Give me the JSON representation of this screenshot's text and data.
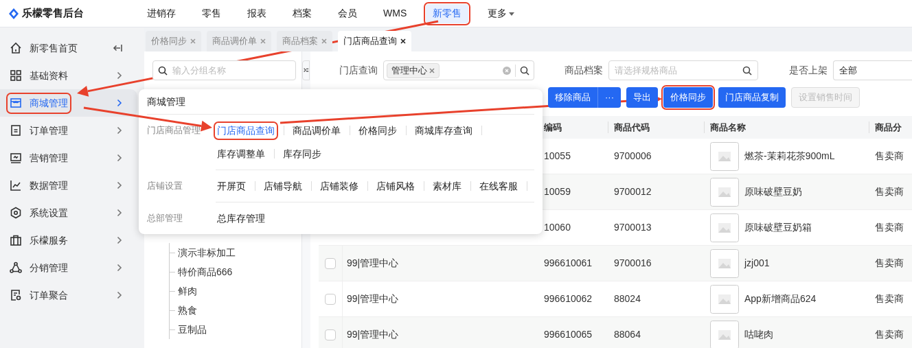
{
  "app": {
    "title": "乐檬零售后台"
  },
  "top_nav": [
    {
      "label": "进销存",
      "kind": "link",
      "selected": false,
      "annotated": false
    },
    {
      "label": "零售",
      "kind": "link",
      "selected": false,
      "annotated": false
    },
    {
      "label": "报表",
      "kind": "link",
      "selected": false,
      "annotated": false
    },
    {
      "label": "档案",
      "kind": "link",
      "selected": false,
      "annotated": false
    },
    {
      "label": "会员",
      "kind": "link",
      "selected": false,
      "annotated": false
    },
    {
      "label": "WMS",
      "kind": "link",
      "selected": false,
      "annotated": false
    },
    {
      "label": "新零售",
      "kind": "link",
      "selected": true,
      "annotated": true
    },
    {
      "label": "更多",
      "kind": "dropdown",
      "selected": false,
      "annotated": false
    }
  ],
  "sidebar": {
    "items": [
      {
        "label": "新零售首页",
        "kind": "collapse",
        "selected": false,
        "annotated": false
      },
      {
        "label": "基础资料",
        "kind": "submenu",
        "selected": false,
        "annotated": false
      },
      {
        "label": "商城管理",
        "kind": "submenu",
        "selected": true,
        "annotated": true
      },
      {
        "label": "订单管理",
        "kind": "submenu",
        "selected": false,
        "annotated": false
      },
      {
        "label": "营销管理",
        "kind": "submenu",
        "selected": false,
        "annotated": false
      },
      {
        "label": "数据管理",
        "kind": "submenu",
        "selected": false,
        "annotated": false
      },
      {
        "label": "系统设置",
        "kind": "submenu",
        "selected": false,
        "annotated": false
      },
      {
        "label": "乐檬服务",
        "kind": "submenu",
        "selected": false,
        "annotated": false
      },
      {
        "label": "分销管理",
        "kind": "submenu",
        "selected": false,
        "annotated": false
      },
      {
        "label": "订单聚合",
        "kind": "submenu",
        "selected": false,
        "annotated": false
      }
    ]
  },
  "tabs": [
    {
      "label": "价格同步",
      "selected": false
    },
    {
      "label": "商品调价单",
      "selected": false
    },
    {
      "label": "商品档案",
      "selected": false
    },
    {
      "label": "门店商品查询",
      "selected": true
    }
  ],
  "tree_panel": {
    "search_placeholder": "输入分组名称",
    "items": [
      "演示非标加工",
      "特价商品666",
      "鲜肉",
      "熟食",
      "豆制品"
    ]
  },
  "filters": [
    {
      "label": "门店查询",
      "kind": "tags",
      "tags": [
        "管理中心"
      ]
    },
    {
      "label": "商品档案",
      "kind": "search",
      "placeholder": "请选择规格商品"
    },
    {
      "label": "是否上架",
      "kind": "select",
      "value": "全部"
    }
  ],
  "toolbar": [
    {
      "label": "移除商品",
      "kind": "split",
      "disabled": false,
      "annotated": false,
      "more": "···"
    },
    {
      "label": "导出",
      "kind": "button",
      "disabled": false,
      "annotated": false
    },
    {
      "label": "价格同步",
      "kind": "button",
      "disabled": false,
      "annotated": true
    },
    {
      "label": "门店商品复制",
      "kind": "button",
      "disabled": false,
      "annotated": false
    },
    {
      "label": "设置销售时间",
      "kind": "button",
      "disabled": true,
      "annotated": false
    }
  ],
  "table": {
    "columns": [
      "编码",
      "商品代码",
      "商品名称",
      "商品分"
    ],
    "rows": [
      {
        "code": "10055",
        "product_code": "9700006",
        "name": "燃茶-茉莉花茶900mL",
        "category": "售卖商"
      },
      {
        "code": "10059",
        "product_code": "9700012",
        "name": "原味破壁豆奶",
        "category": "售卖商"
      },
      {
        "code": "10060",
        "product_code": "9700013",
        "name": "原味破壁豆奶箱",
        "category": "售卖商"
      },
      {
        "checked": false,
        "store": "99|管理中心",
        "code": "996610061",
        "product_code": "9700016",
        "name": "jzj001",
        "category": "售卖商"
      },
      {
        "checked": false,
        "store": "99|管理中心",
        "code": "996610062",
        "product_code": "88024",
        "name": "App新增商品624",
        "category": "售卖商"
      },
      {
        "checked": false,
        "store": "99|管理中心",
        "code": "996610065",
        "product_code": "88064",
        "name": "咕咾肉",
        "category": "售卖商"
      }
    ]
  },
  "menu": {
    "title": "商城管理",
    "groups": [
      {
        "label": "门店商品管理",
        "rows": [
          [
            {
              "label": "门店商品查询",
              "selected": true,
              "annotated": true
            },
            {
              "label": "商品调价单",
              "selected": false,
              "annotated": false
            },
            {
              "label": "价格同步",
              "selected": false,
              "annotated": false
            },
            {
              "label": "商城库存查询",
              "selected": false,
              "annotated": false
            }
          ],
          [
            {
              "label": "库存调整单",
              "selected": false,
              "annotated": false
            },
            {
              "label": "库存同步",
              "selected": false,
              "annotated": false
            }
          ]
        ]
      },
      {
        "label": "店铺设置",
        "rows": [
          [
            {
              "label": "开屏页",
              "selected": false,
              "annotated": false
            },
            {
              "label": "店铺导航",
              "selected": false,
              "annotated": false
            },
            {
              "label": "店铺装修",
              "selected": false,
              "annotated": false
            },
            {
              "label": "店铺风格",
              "selected": false,
              "annotated": false
            },
            {
              "label": "素材库",
              "selected": false,
              "annotated": false
            },
            {
              "label": "在线客服",
              "selected": false,
              "annotated": false
            }
          ]
        ]
      },
      {
        "label": "总部管理",
        "rows": [
          [
            {
              "label": "总库存管理",
              "selected": false,
              "annotated": false
            }
          ]
        ]
      }
    ]
  }
}
